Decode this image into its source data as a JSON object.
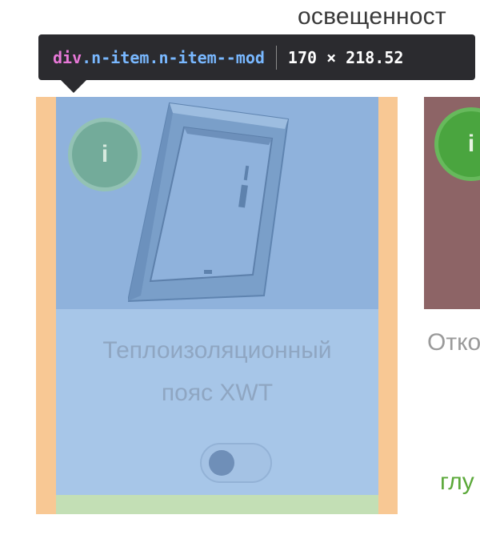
{
  "header": {
    "partial_text": "освещенност"
  },
  "devtools_tooltip": {
    "tag": "div",
    "classes": ".n-item.n-item--mod",
    "dimensions": "170 × 218.52"
  },
  "items": [
    {
      "info_label": "i",
      "title_line1": "Теплоизоляционный",
      "title_line2": "пояс XWT",
      "toggle_state": "off",
      "image_icon": "roof-window-frame-icon"
    },
    {
      "info_label": "i",
      "title_partial": "Отко",
      "link_partial": "глу"
    }
  ],
  "colors": {
    "padding_overlay": "#f8c894",
    "content_overlay": "#a7c6e8",
    "margin_overlay": "#c3dfb5",
    "accent_green": "#4aa53f",
    "tooltip_bg": "#2b2b2f"
  }
}
